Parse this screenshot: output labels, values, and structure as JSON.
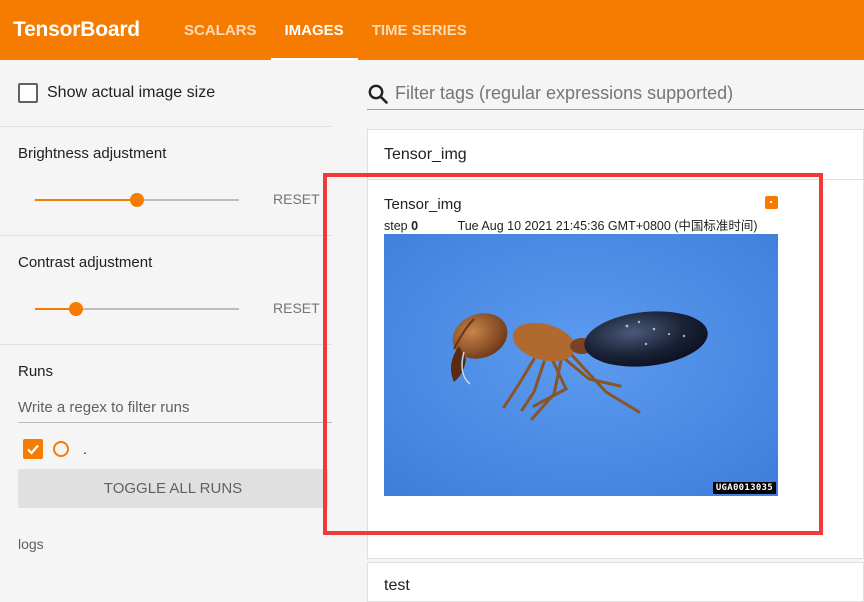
{
  "app": {
    "title": "TensorBoard",
    "tabs": [
      {
        "label": "SCALARS",
        "active": false
      },
      {
        "label": "IMAGES",
        "active": true
      },
      {
        "label": "TIME SERIES",
        "active": false
      }
    ],
    "accent_color": "#f57c00",
    "highlight_color": "#ee3a3a"
  },
  "sidebar": {
    "show_actual_size": {
      "label": "Show actual image size",
      "checked": false
    },
    "brightness": {
      "label": "Brightness adjustment",
      "value": 0.5,
      "reset": "RESET"
    },
    "contrast": {
      "label": "Contrast adjustment",
      "value": 0.2,
      "reset": "RESET"
    },
    "runs": {
      "title": "Runs",
      "filter_placeholder": "Write a regex to filter runs",
      "items": [
        {
          "name": ".",
          "checked": true
        }
      ],
      "toggle_all": "TOGGLE ALL RUNS",
      "logdir": "logs"
    }
  },
  "main": {
    "search_placeholder": "Filter tags (regular expressions supported)",
    "cards": [
      {
        "title": "Tensor_img",
        "image": {
          "tag": "Tensor_img",
          "step_label": "step",
          "step": "0",
          "timestamp": "Tue Aug 10 2021 21:45:36 GMT+0800 (中国标准时间)",
          "watermark": "UGA0013035"
        }
      },
      {
        "title": "test"
      }
    ]
  }
}
